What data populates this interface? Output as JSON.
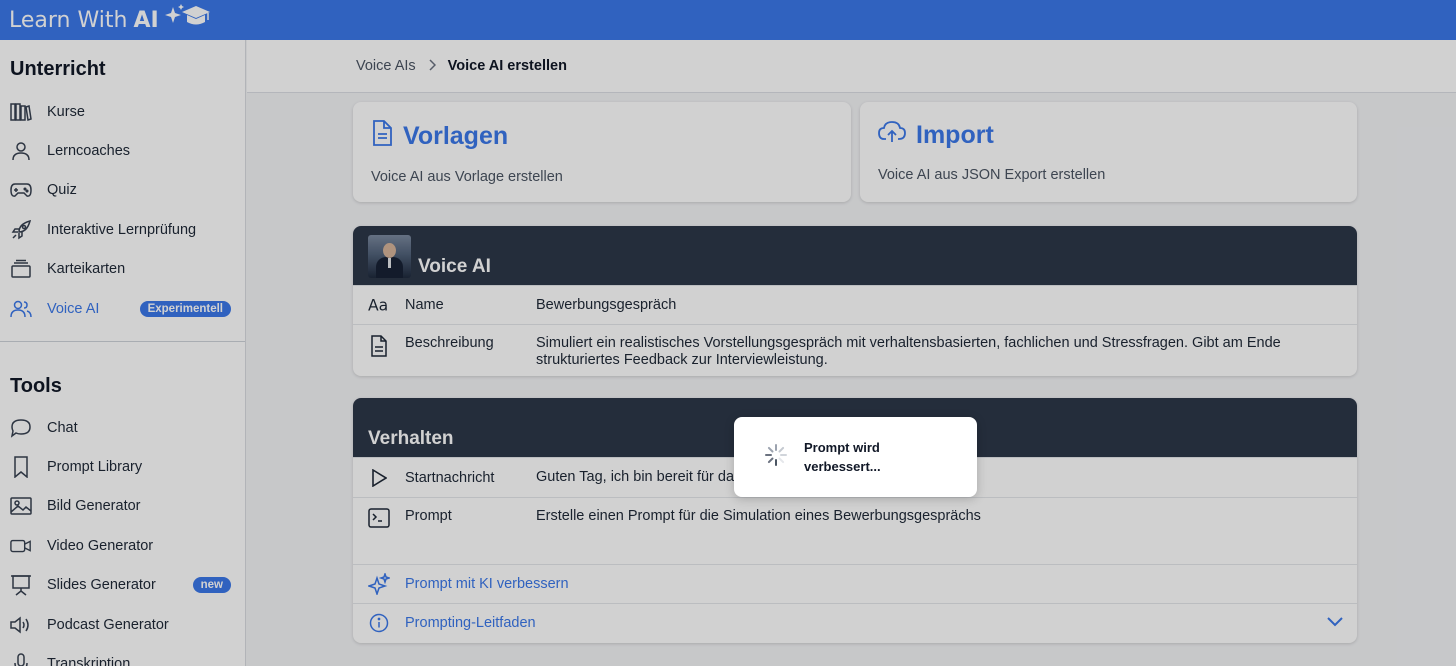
{
  "app": {
    "logo_text": "Learn With",
    "logo_ai": "AI"
  },
  "sidebar": {
    "section1_title": "Unterricht",
    "section1_items": [
      {
        "label": "Kurse",
        "icon": "books-icon"
      },
      {
        "label": "Lerncoaches",
        "icon": "user-icon"
      },
      {
        "label": "Quiz",
        "icon": "gamepad-icon"
      },
      {
        "label": "Interaktive Lernprüfung",
        "icon": "rocket-icon"
      },
      {
        "label": "Karteikarten",
        "icon": "cards-icon"
      },
      {
        "label": "Voice AI",
        "icon": "users-icon",
        "badge": "Experimentell",
        "active": true
      }
    ],
    "section2_title": "Tools",
    "section2_items": [
      {
        "label": "Chat",
        "icon": "chat-icon"
      },
      {
        "label": "Prompt Library",
        "icon": "bookmark-icon"
      },
      {
        "label": "Bild Generator",
        "icon": "image-icon"
      },
      {
        "label": "Video Generator",
        "icon": "video-icon"
      },
      {
        "label": "Slides Generator",
        "icon": "presentation-icon",
        "badge": "new"
      },
      {
        "label": "Podcast Generator",
        "icon": "speaker-icon"
      },
      {
        "label": "Transkription",
        "icon": "mic-icon"
      }
    ]
  },
  "breadcrumb": {
    "parent": "Voice AIs",
    "separator": ">",
    "current": "Voice AI erstellen"
  },
  "options": {
    "templates": {
      "title": "Vorlagen",
      "subtitle": "Voice AI aus Vorlage erstellen"
    },
    "import": {
      "title": "Import",
      "subtitle": "Voice AI aus JSON Export erstellen"
    }
  },
  "voice_ai": {
    "title": "Voice AI",
    "name_label": "Name",
    "name_value": "Bewerbungsgespräch",
    "description_label": "Beschreibung",
    "description_value": "Simuliert ein realistisches Vorstellungsgespräch mit verhaltensbasierten, fachlichen und Stressfragen. Gibt am Ende strukturiertes Feedback zur Interviewleistung."
  },
  "behavior": {
    "title": "Verhalten",
    "start_label": "Startnachricht",
    "start_value": "Guten Tag, ich bin bereit für da",
    "prompt_label": "Prompt",
    "prompt_value": "Erstelle einen Prompt für die Simulation eines Bewerbungsgesprächs",
    "improve_link": "Prompt mit KI verbessern",
    "guide_link": "Prompting-Leitfaden"
  },
  "toast": {
    "text": "Prompt wird verbessert..."
  },
  "colors": {
    "primary": "#3b78ea",
    "panel_header": "#2d3748",
    "badge": "#3b78ea"
  }
}
